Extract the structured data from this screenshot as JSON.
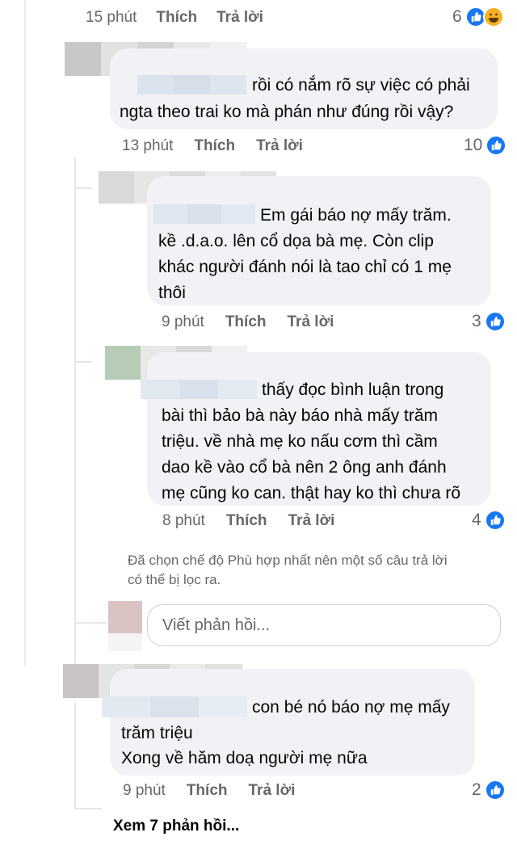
{
  "top_meta": {
    "time": "15 phút",
    "like": "Thích",
    "reply": "Trả lời",
    "count": "6"
  },
  "comments": [
    {
      "lines": [
        "rồi có nắm rõ sự việc có phải",
        "ngta theo trai ko mà phán như đúng rồi vậy?"
      ],
      "time": "13 phút",
      "like": "Thích",
      "reply": "Trả lời",
      "count": "10"
    },
    {
      "lines": [
        "Em gái báo nợ mấy trăm.",
        "kề .d.a.o. lên cổ dọa bà mẹ. Còn clip",
        "khác người đánh nói là tao chỉ có 1 mẹ",
        "thôi"
      ],
      "time": "9 phút",
      "like": "Thích",
      "reply": "Trả lời",
      "count": "3"
    },
    {
      "lines": [
        "thấy đọc bình luận trong",
        "bài thì bảo bà này báo nhà mấy trăm",
        "triệu. về nhà mẹ ko nấu cơm thì cầm",
        "dao kề vào cổ bà nên 2 ông anh đánh",
        "mẹ cũng ko can. thật hay ko thì chưa rõ"
      ],
      "time": "8 phút",
      "like": "Thích",
      "reply": "Trả lời",
      "count": "4"
    },
    {
      "lines": [
        "con bé nó báo nợ mẹ mấy",
        "trăm triệu",
        "Xong về hăm doạ người mẹ nữa"
      ],
      "time": "9 phút",
      "like": "Thích",
      "reply": "Trả lời",
      "count": "2"
    }
  ],
  "filter_note": [
    "Đã chọn chế độ Phù hợp nhất nên một số câu trả lời",
    "có thể bị lọc ra."
  ],
  "reply_placeholder": "Viết phản hồi...",
  "view_more": "Xem 7 phản hồi...",
  "icons": {
    "like": "like-icon",
    "haha": "haha-icon"
  },
  "colors": {
    "like_blue": "#1877f2",
    "meta_gray": "#65676b",
    "bubble_bg": "#f0f2f5"
  }
}
